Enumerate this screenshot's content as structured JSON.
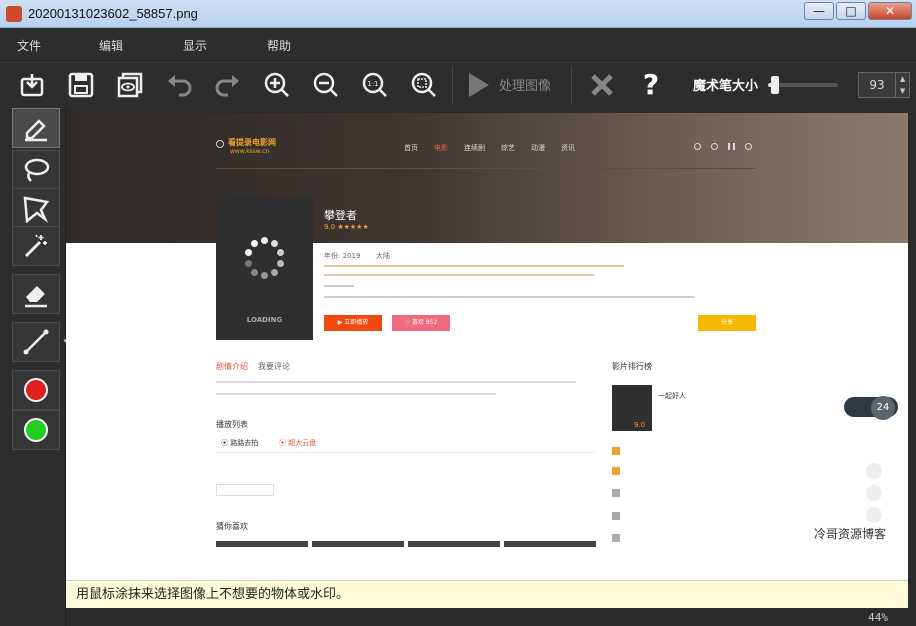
{
  "window": {
    "title": "20200131023602_58857.png",
    "min": "—",
    "max": "□",
    "close": "✕"
  },
  "menu": {
    "file": "文件",
    "edit": "编辑",
    "view": "显示",
    "help": "帮助"
  },
  "toolbar": {
    "process_label": "处理图像",
    "brush_size_label": "魔术笔大小",
    "brush_size_value": "93",
    "help": "?"
  },
  "brush": {
    "level_fraction": 0.1
  },
  "colors": {
    "red": "#e02020",
    "green": "#22cc22",
    "background": "#2b2b2b"
  },
  "hint": "用鼠标涂抹来选择图像上不想要的物体或水印。",
  "zoom": "44%",
  "webpage": {
    "logo_text": "看提录电影网",
    "logo_url": "www.kssw.cn",
    "nav": [
      "首页",
      "电影",
      "连续剧",
      "综艺",
      "动漫",
      "资讯"
    ],
    "movie_title": "攀登者",
    "rating": "9.0 ★★★★★",
    "year": "年份: 2019",
    "region": "大陆",
    "poster_loading": "LOADING",
    "btn_play": "▶ 立即播放",
    "btn_like": "♡ 喜欢 852",
    "btn_share": "分享",
    "tab_intro": "剧情介绍",
    "tab_comment": "我要评论",
    "playlist_title": "播放列表",
    "source1": "⦿ 路路去拍",
    "source2": "⦿ 超大云盘",
    "more_title": "猜你喜欢",
    "rank_title": "影片排行榜",
    "rank_first": "一起好人",
    "rank_score": "9.0",
    "sidebar_counter": "24",
    "watermark": "冷哥资源博客"
  }
}
